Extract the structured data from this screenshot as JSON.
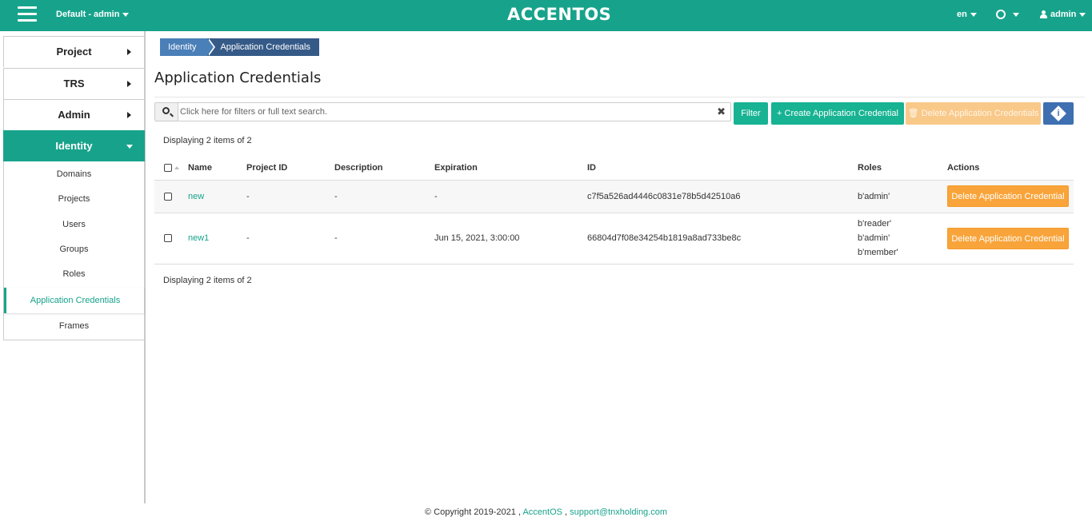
{
  "header": {
    "project_switcher": "Default - admin",
    "brand": "ACCENTOS",
    "language": "en",
    "user": "admin"
  },
  "sidebar": {
    "main": [
      {
        "label": "Project"
      },
      {
        "label": "TRS"
      },
      {
        "label": "Admin"
      },
      {
        "label": "Identity"
      }
    ],
    "sub": [
      {
        "label": "Domains"
      },
      {
        "label": "Projects"
      },
      {
        "label": "Users"
      },
      {
        "label": "Groups"
      },
      {
        "label": "Roles"
      },
      {
        "label": "Application Credentials"
      },
      {
        "label": "Frames"
      }
    ]
  },
  "breadcrumb": [
    "Identity",
    "Application Credentials"
  ],
  "page_title": "Application Credentials",
  "search": {
    "placeholder": "Click here for filters or full text search."
  },
  "toolbar": {
    "filter": "Filter",
    "create": "+ Create Application Credential",
    "delete_all": "🗑 Delete Application Credentials"
  },
  "count_text": "Displaying 2 items of 2",
  "table": {
    "headers": [
      "Name",
      "Project ID",
      "Description",
      "Expiration",
      "ID",
      "Roles",
      "Actions"
    ],
    "rows": [
      {
        "name": "new",
        "project_id": "-",
        "description": "-",
        "expiration": "-",
        "id": "c7f5a526ad4446c0831e78b5d42510a6",
        "roles": [
          "b'admin'"
        ],
        "action": "Delete Application Credential"
      },
      {
        "name": "new1",
        "project_id": "-",
        "description": "-",
        "expiration": "Jun 15, 2021, 3:00:00",
        "id": "66804d7f08e34254b1819a8ad733be8c",
        "roles": [
          "b'reader'",
          "b'admin'",
          "b'member'"
        ],
        "action": "Delete Application Credential"
      }
    ]
  },
  "footer": {
    "copyright": "© Copyright 2019-2021 ,",
    "brand_link": "AccentOS",
    "separator": ",",
    "email": "support@tnxholding.com"
  },
  "colors": {
    "primary": "#17a38b",
    "breadcrumb_dark": "#355a88",
    "breadcrumb_light": "#4a7fb8",
    "warning": "#f8a43a"
  }
}
